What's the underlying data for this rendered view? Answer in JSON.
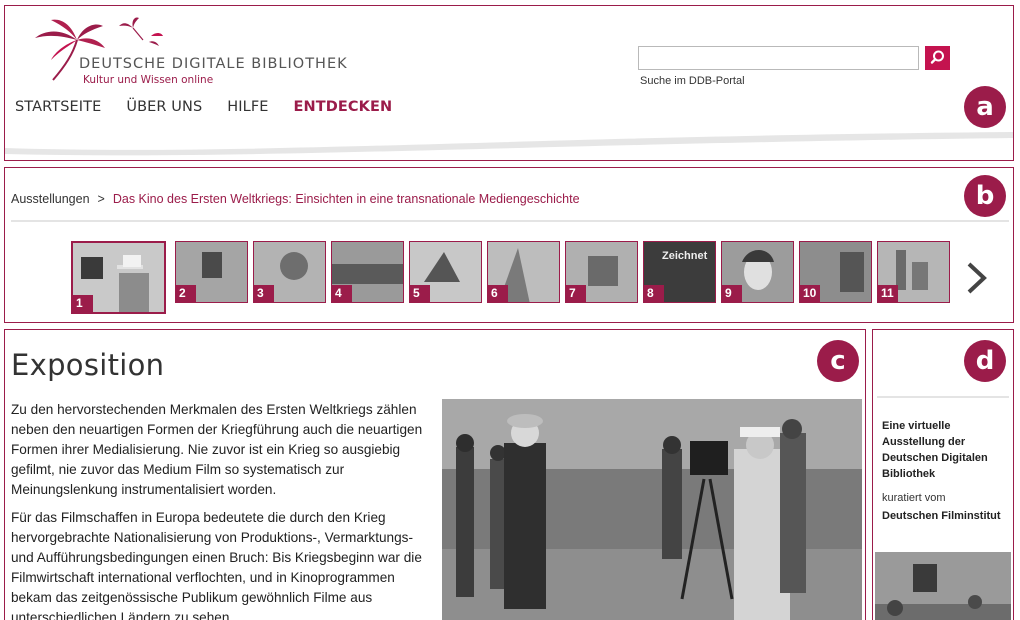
{
  "header": {
    "logo_title": "DEUTSCHE DIGITALE BIBLIOTHEK",
    "logo_subtitle": "Kultur und Wissen online",
    "search_placeholder": "",
    "search_hint": "Suche im DDB-Portal",
    "nav": [
      {
        "label": "STARTSEITE",
        "active": false
      },
      {
        "label": "ÜBER UNS",
        "active": false
      },
      {
        "label": "HILFE",
        "active": false
      },
      {
        "label": "ENTDECKEN",
        "active": true
      }
    ],
    "badge": "a"
  },
  "breadcrumb": {
    "root": "Ausstellungen",
    "separator": ">",
    "current": "Das Kino des Ersten Weltkriegs: Einsichten in eine transnationale Mediengeschichte",
    "badge": "b"
  },
  "thumbnails": {
    "items": [
      "1",
      "2",
      "3",
      "4",
      "5",
      "6",
      "7",
      "8",
      "9",
      "10",
      "11"
    ],
    "selected": "1",
    "thumb8_caption": "Zeichnet",
    "next_icon": "chevron-right-icon"
  },
  "main": {
    "title": "Exposition",
    "badge": "c",
    "paragraphs": [
      "Zu den hervorstechenden Merkmalen des Ersten Weltkriegs zählen neben den neuartigen Formen der Kriegführung auch die neuartigen Formen ihrer Medialisierung. Nie zuvor ist ein Krieg so ausgiebig gefilmt, nie zuvor das Medium Film so systematisch zur Meinungslenkung instrumentalisiert worden.",
      "Für das Filmschaffen in Europa bedeutete die durch den Krieg hervorgebrachte Nationalisierung von Produktions-, Vermarktungs- und Aufführungsbedingungen einen Bruch: Bis Kriegsbeginn war die Filmwirtschaft international verflochten, und in Kinoprogrammen bekam das zeitgenössische Publikum gewöhnlich Filme aus unterschiedlichen Ländern zu sehen."
    ]
  },
  "aside": {
    "badge": "d",
    "title": "Eine virtuelle Ausstellung der Deutschen Digitalen Bibliothek",
    "by": "kuratiert vom",
    "org": "Deutschen Filminstitut"
  },
  "colors": {
    "accent": "#9b1c4a",
    "search_button": "#c4134f"
  }
}
